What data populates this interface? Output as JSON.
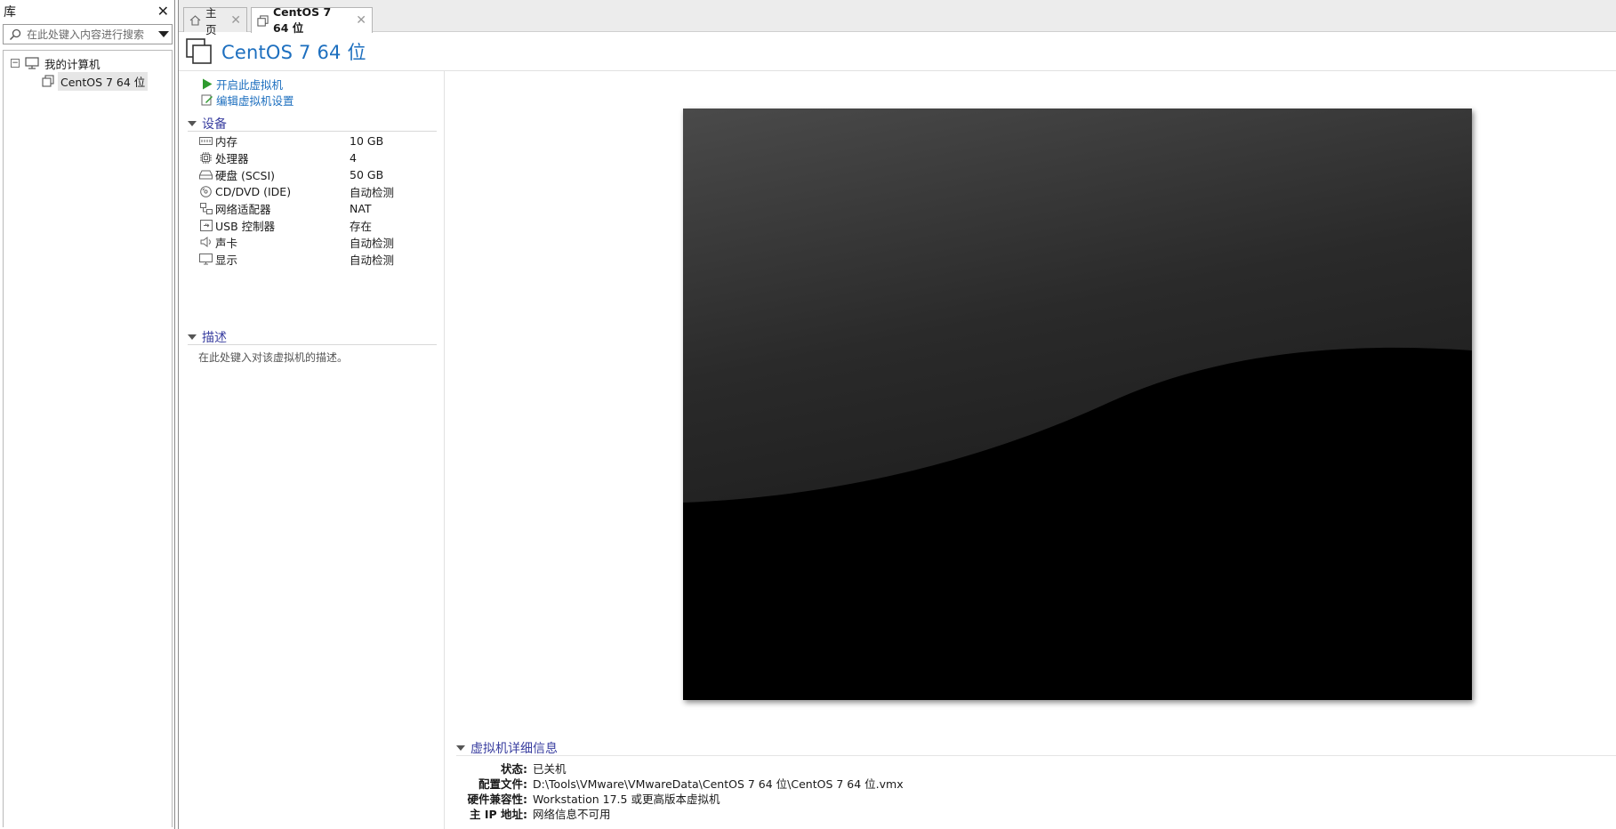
{
  "library": {
    "title": "库",
    "close_symbol": "✕",
    "search_placeholder": "在此处键入内容进行搜索",
    "tree": {
      "root_toggle": "−",
      "root_label": "我的计算机",
      "child_label": "CentOS 7 64 位"
    }
  },
  "tabs": [
    {
      "label": "主页",
      "icon": "home-icon",
      "close": "✕"
    },
    {
      "label": "CentOS 7 64 位",
      "icon": "vm-icon",
      "close": "✕"
    }
  ],
  "vm": {
    "title": "CentOS 7 64 位",
    "actions": {
      "power_on": "开启此虚拟机",
      "edit_settings": "编辑虚拟机设置"
    },
    "devices_header": "设备",
    "devices": [
      {
        "name": "内存",
        "value": "10 GB",
        "icon": "memory-icon"
      },
      {
        "name": "处理器",
        "value": "4",
        "icon": "cpu-icon"
      },
      {
        "name": "硬盘 (SCSI)",
        "value": "50 GB",
        "icon": "harddisk-icon"
      },
      {
        "name": "CD/DVD (IDE)",
        "value": "自动检测",
        "icon": "cd-icon"
      },
      {
        "name": "网络适配器",
        "value": "NAT",
        "icon": "network-icon"
      },
      {
        "name": "USB 控制器",
        "value": "存在",
        "icon": "usb-icon"
      },
      {
        "name": "声卡",
        "value": "自动检测",
        "icon": "sound-icon"
      },
      {
        "name": "显示",
        "value": "自动检测",
        "icon": "display-icon"
      }
    ],
    "description_header": "描述",
    "description_placeholder": "在此处键入对该虚拟机的描述。",
    "details_header": "虚拟机详细信息",
    "details": [
      {
        "key": "状态:",
        "value": "已关机"
      },
      {
        "key": "配置文件:",
        "value": "D:\\Tools\\VMware\\VMwareData\\CentOS 7 64 位\\CentOS 7 64 位.vmx"
      },
      {
        "key": "硬件兼容性:",
        "value": "Workstation 17.5 或更高版本虚拟机"
      },
      {
        "key": "主 IP 地址:",
        "value": "网络信息不可用"
      }
    ]
  },
  "colors": {
    "link": "#1d6fbf",
    "section": "#3a3fa0",
    "play": "#2e9a2e"
  }
}
